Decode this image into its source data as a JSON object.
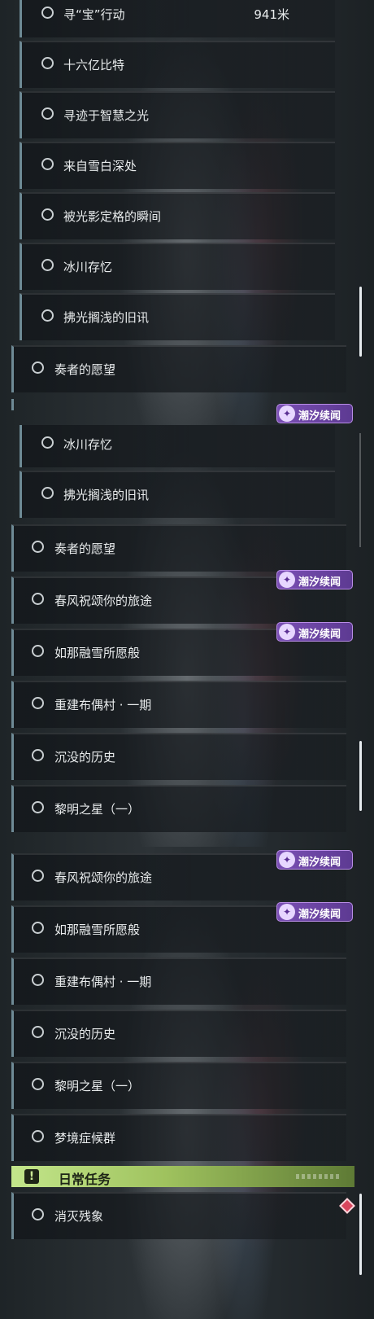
{
  "badge_label": "潮汐续闻",
  "badge_icon": "tidal-story-icon",
  "panel1": {
    "first_item": {
      "label": "寻“宝”行动",
      "distance": "941米"
    },
    "items": [
      "十六亿比特",
      "寻迹于智慧之光",
      "来自雪白深处",
      "被光影定格的瞬间",
      "冰川存忆",
      "拂光搁浅的旧讯"
    ],
    "main_item": "奏者的愿望"
  },
  "panel2": {
    "items": [
      "冰川存忆",
      "拂光搁浅的旧讯"
    ],
    "main_items": [
      "奏者的愿望",
      "春风祝颂你的旅途",
      "如那融雪所愿般",
      "重建布偶村 · 一期",
      "沉没的历史",
      "黎明之星（一）"
    ]
  },
  "panel3": {
    "main_items": [
      "春风祝颂你的旅途",
      "如那融雪所愿般",
      "重建布偶村 · 一期",
      "沉没的历史",
      "黎明之星（一）",
      "梦境症候群"
    ],
    "section": {
      "title": "日常任务",
      "icon": "exclamation-icon"
    },
    "daily_items": [
      "消灭残象"
    ]
  },
  "colors": {
    "accent_bar": "#6e8a95",
    "badge": "#7a4fb4",
    "section": "#b6d97a",
    "marker": "#d9465d"
  }
}
